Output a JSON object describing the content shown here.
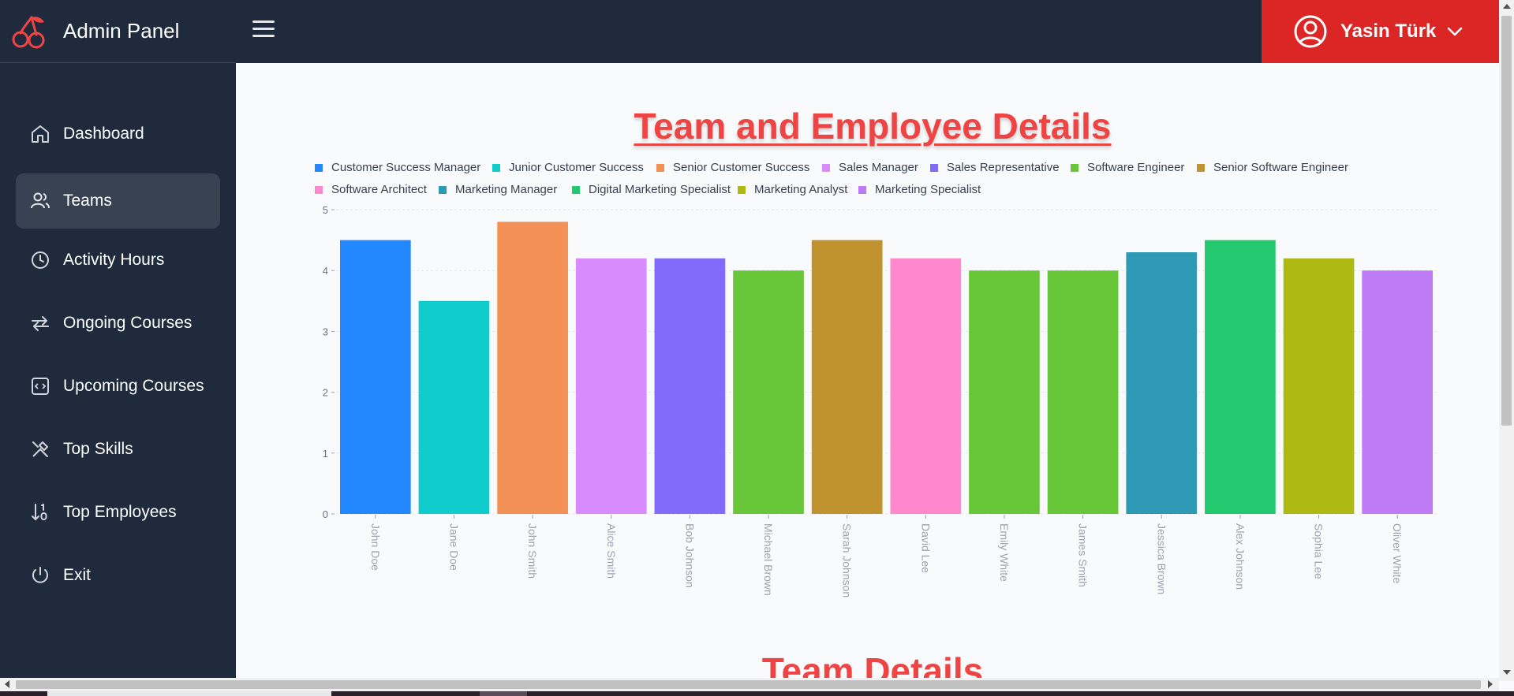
{
  "header": {
    "app_title": "Admin Panel",
    "logo_icon": "cherry-icon",
    "menu_icon": "hamburger-icon",
    "user": {
      "name": "Yasin Türk",
      "icon": "user-circle-icon",
      "chevron_icon": "chevron-down-icon"
    }
  },
  "colors": {
    "nav_bg": "#1f2a3c",
    "accent": "#dc2626",
    "title": "#ef4444",
    "active_item": "#374253"
  },
  "sidebar": {
    "items": [
      {
        "label": "Dashboard",
        "icon": "home-icon",
        "active": false
      },
      {
        "label": "Teams",
        "icon": "users-icon",
        "active": true
      },
      {
        "label": "Activity Hours",
        "icon": "clock-icon",
        "active": false
      },
      {
        "label": "Ongoing Courses",
        "icon": "repeat-icon",
        "active": false
      },
      {
        "label": "Upcoming Courses",
        "icon": "code-square-icon",
        "active": false
      },
      {
        "label": "Top Skills",
        "icon": "tools-icon",
        "active": false
      },
      {
        "label": "Top Employees",
        "icon": "sort-ascending-icon",
        "active": false
      },
      {
        "label": "Exit",
        "icon": "power-icon",
        "active": false
      }
    ]
  },
  "main": {
    "page_title": "Team and Employee Details",
    "section_title": "Team Details"
  },
  "chart_data": {
    "type": "bar",
    "title": "",
    "xlabel": "",
    "ylabel": "",
    "ylim": [
      0,
      5
    ],
    "yticks": [
      "0",
      "1",
      "2",
      "3",
      "4",
      "5"
    ],
    "grid": true,
    "legend_position": "top",
    "legend": [
      {
        "name": "Customer Success Manager",
        "color": "#2388ff"
      },
      {
        "name": "Junior Customer Success",
        "color": "#10cccc"
      },
      {
        "name": "Senior Customer Success",
        "color": "#f29055"
      },
      {
        "name": "Sales Manager",
        "color": "#d98afc"
      },
      {
        "name": "Sales Representative",
        "color": "#826bfb"
      },
      {
        "name": "Software Engineer",
        "color": "#68c639"
      },
      {
        "name": "Senior Software Engineer",
        "color": "#c1932f"
      },
      {
        "name": "Software Architect",
        "color": "#ff88cc"
      },
      {
        "name": "Marketing Manager",
        "color": "#2f9ab5"
      },
      {
        "name": "Digital Marketing Specialist",
        "color": "#24c96f"
      },
      {
        "name": "Marketing Analyst",
        "color": "#aeba13"
      },
      {
        "name": "Marketing Specialist",
        "color": "#bf7af6"
      }
    ],
    "categories": [
      "John Doe",
      "Jane Doe",
      "John Smith",
      "Alice Smith",
      "Bob Johnson",
      "Michael Brown",
      "Sarah Johnson",
      "David Lee",
      "Emily White",
      "James Smith",
      "Jessica Brown",
      "Alex Johnson",
      "Sophia Lee",
      "Oliver White"
    ],
    "values": [
      4.5,
      3.5,
      4.8,
      4.2,
      4.2,
      4.0,
      4.5,
      4.2,
      4.0,
      4.0,
      4.3,
      4.5,
      4.2,
      4.0
    ],
    "bar_colors": [
      "#2388ff",
      "#10cccc",
      "#f29055",
      "#d98afc",
      "#826bfb",
      "#68c639",
      "#c1932f",
      "#ff88cc",
      "#68c639",
      "#68c639",
      "#2f9ab5",
      "#24c96f",
      "#aeba13",
      "#bf7af6"
    ]
  }
}
